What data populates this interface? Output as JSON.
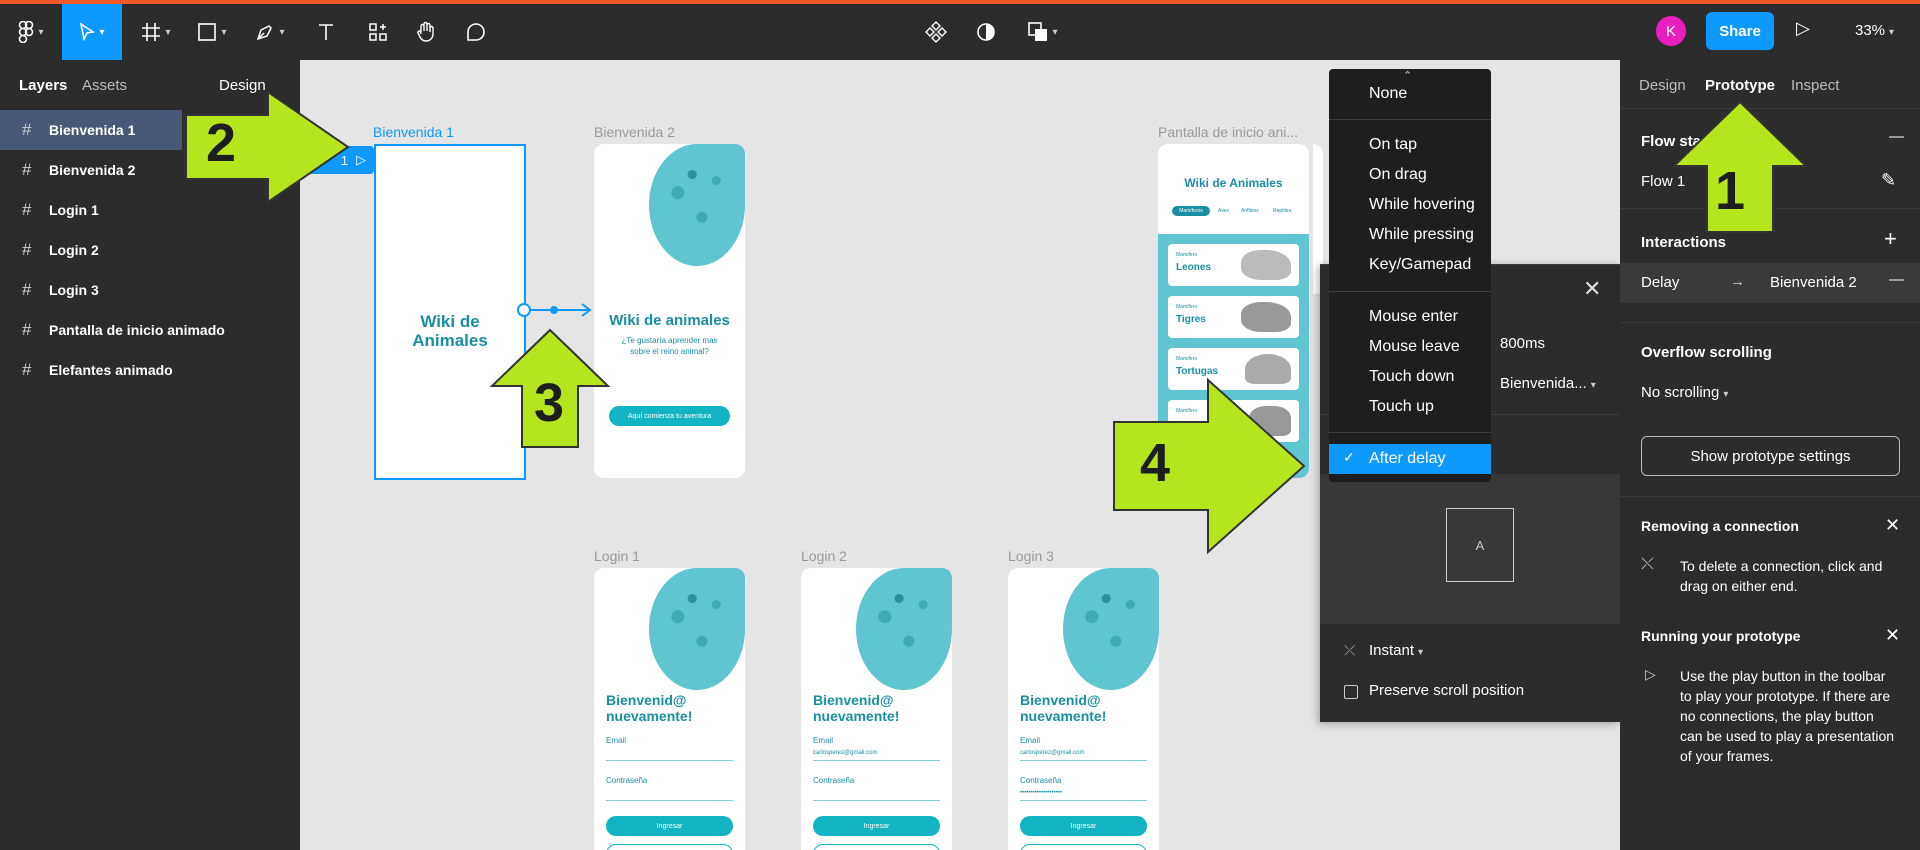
{
  "toolbar": {
    "tools": [
      "figma-menu",
      "move",
      "frame",
      "shape",
      "pen",
      "text",
      "resources",
      "hand",
      "comment"
    ],
    "center_tools": [
      "components",
      "theme",
      "boolean"
    ],
    "avatar_initial": "K",
    "share_label": "Share",
    "zoom": "33%"
  },
  "left_panel": {
    "tabs": [
      "Layers",
      "Assets",
      "Design"
    ],
    "layers": [
      "Bienvenida 1",
      "Bienvenida 2",
      "Login 1",
      "Login 2",
      "Login 3",
      "Pantalla de inicio animado",
      "Elefantes animado"
    ],
    "selected_layer": "Bienvenida 1"
  },
  "canvas": {
    "flow_badge": "1",
    "frames": {
      "bienvenida1": {
        "label": "Bienvenida 1",
        "title_line1": "Wiki de",
        "title_line2": "Animales"
      },
      "bienvenida2": {
        "label": "Bienvenida 2",
        "title": "Wiki de animales",
        "subtitle_line1": "¿Te gustaría aprender mas",
        "subtitle_line2": "sobre el reino animal?",
        "button": "Aquí comienza tu aventura"
      },
      "pantalla": {
        "label": "Pantalla de inicio ani...",
        "title": "Wiki de Animales",
        "chips": [
          "Mamíferos",
          "Aves",
          "Anfibios",
          "Reptiles"
        ],
        "cards": [
          {
            "kicker": "Mamífero",
            "name": "Leones"
          },
          {
            "kicker": "Mamífero",
            "name": "Tigres"
          },
          {
            "kicker": "Mamífero",
            "name": "Tortugas"
          },
          {
            "kicker": "Mamífero",
            "name": ""
          }
        ]
      },
      "logins": [
        {
          "label": "Login 1",
          "heading_line1": "Bienvenid@",
          "heading_line2": "nuevamente!",
          "email_label": "Email",
          "email_value": "",
          "password_label": "Contraseña",
          "password_value": "",
          "button": "Ingresar"
        },
        {
          "label": "Login 2",
          "heading_line1": "Bienvenid@",
          "heading_line2": "nuevamente!",
          "email_label": "Email",
          "email_value": "carlosperez@gmail.com",
          "password_label": "Contraseña",
          "password_value": "",
          "button": "Ingresar"
        },
        {
          "label": "Login 3",
          "heading_line1": "Bienvenid@",
          "heading_line2": "nuevamente!",
          "email_label": "Email",
          "email_value": "carlosperez@gmail.com",
          "password_label": "Contraseña",
          "password_value": "••••••••••••••••••••",
          "button": "Ingresar"
        }
      ]
    }
  },
  "trigger_dropdown": {
    "items_group1": [
      "None"
    ],
    "items_group2": [
      "On tap",
      "On drag",
      "While hovering",
      "While pressing",
      "Key/Gamepad"
    ],
    "items_group3": [
      "Mouse enter",
      "Mouse leave",
      "Touch down",
      "Touch up"
    ],
    "selected": "After delay"
  },
  "interaction_panel": {
    "delay_value": "800ms",
    "destination": "Bienvenida...",
    "preview_letter": "A",
    "animation": "Instant",
    "preserve_scroll": "Preserve scroll position"
  },
  "right_panel": {
    "tabs": [
      "Design",
      "Prototype",
      "Inspect"
    ],
    "active_tab": "Prototype",
    "flow_starting_point": "Flow sta",
    "flow_name": "Flow 1",
    "interactions_title": "Interactions",
    "interaction_trigger": "Delay",
    "interaction_destination": "Bienvenida 2",
    "overflow_title": "Overflow scrolling",
    "overflow_value": "No scrolling",
    "show_settings": "Show prototype settings",
    "removing_title": "Removing a connection",
    "removing_desc": "To delete a connection, click and drag on either end.",
    "running_title": "Running your prototype",
    "running_desc": "Use the play button in the toolbar to play your prototype. If there are no connections, the play button can be used to play a presentation of your frames."
  },
  "annotations": {
    "a1": "1",
    "a2": "2",
    "a3": "3",
    "a4": "4"
  },
  "colors": {
    "accent": "#0d99ff",
    "arrow_green": "#b5e61d",
    "teal": "#12b3c2",
    "avatar": "#e91ebf",
    "top_strip": "#f0582a"
  }
}
